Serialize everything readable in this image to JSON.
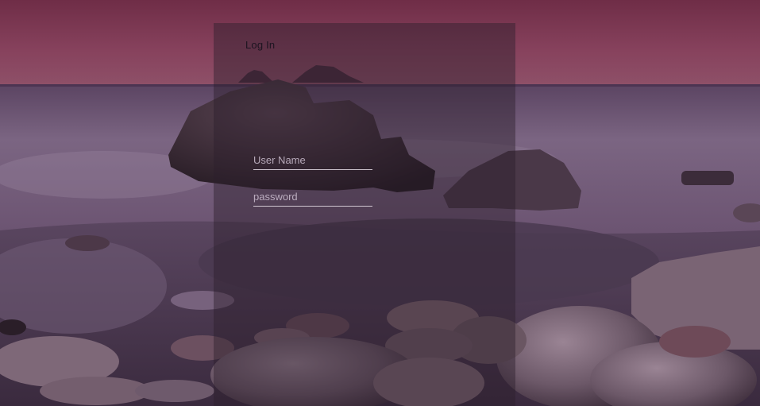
{
  "login": {
    "title": "Log In",
    "username": {
      "placeholder": "User Name",
      "value": ""
    },
    "password": {
      "placeholder": "password",
      "value": ""
    }
  },
  "background": {
    "description_icon": "seascape-background-image",
    "colors": {
      "sky_top": "#7a3550",
      "sky_bottom": "#8a4a62",
      "sea": "#6a4f6e",
      "sand": "#4e3a52",
      "rock": "#2e2230",
      "panel_overlay": "#2d1e2d"
    }
  }
}
